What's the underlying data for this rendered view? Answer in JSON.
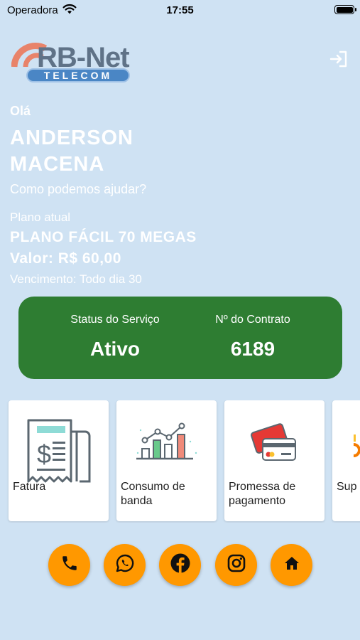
{
  "status_bar": {
    "carrier": "Operadora",
    "time": "17:55"
  },
  "header": {
    "logo_text": "RB-Net",
    "logo_subtext": "TELECOM"
  },
  "greeting": {
    "hello": "Olá",
    "name": "ANDERSON MACENA",
    "help": "Como podemos ajudar?"
  },
  "plan": {
    "label": "Plano atual",
    "name": "PLANO FÁCIL 70 MEGAS",
    "value": "Valor: R$ 60,00",
    "due": "Vencimento: Todo dia 30"
  },
  "service": {
    "status_label": "Status do Serviço",
    "status_value": "Ativo",
    "contract_label": "Nº do Contrato",
    "contract_value": "6189"
  },
  "cards": [
    {
      "label": "Fatura",
      "icon": "invoice-icon"
    },
    {
      "label": "Consumo de banda",
      "icon": "bandwidth-chart-icon"
    },
    {
      "label": "Promessa de pagamento",
      "icon": "credit-card-icon"
    },
    {
      "label": "Sup",
      "icon": "support-icon"
    }
  ],
  "socials": [
    {
      "name": "phone",
      "icon": "phone-icon"
    },
    {
      "name": "whatsapp",
      "icon": "whatsapp-icon"
    },
    {
      "name": "facebook",
      "icon": "facebook-icon"
    },
    {
      "name": "instagram",
      "icon": "instagram-icon"
    },
    {
      "name": "home",
      "icon": "home-icon"
    }
  ],
  "colors": {
    "background": "#cfe2f3",
    "status_card": "#2e7d32",
    "social_button": "#ff9800",
    "logo_orange": "#e8836a",
    "logo_blue": "#4a86c5"
  }
}
